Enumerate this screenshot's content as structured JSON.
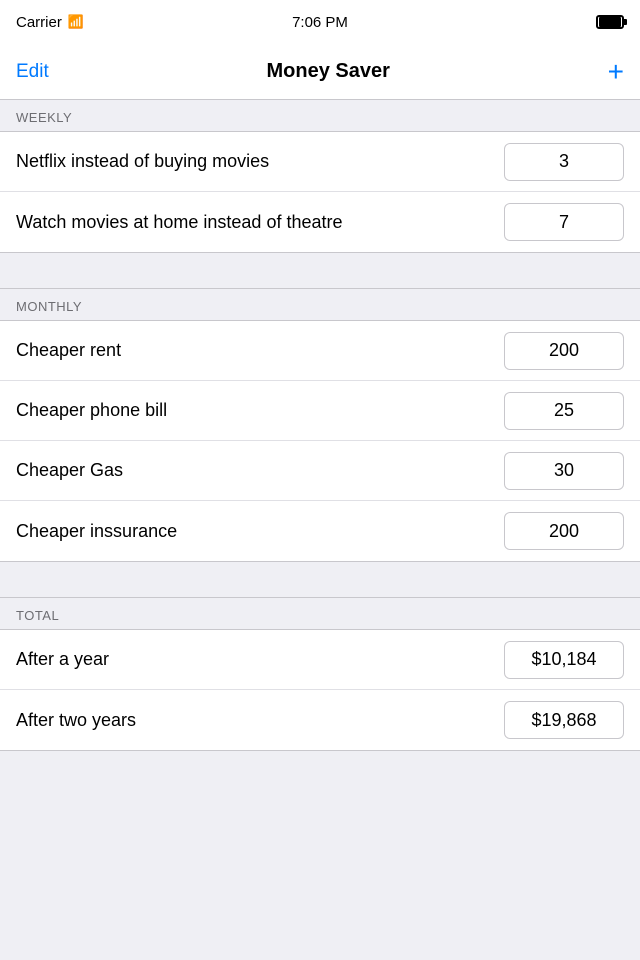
{
  "status_bar": {
    "carrier": "Carrier",
    "wifi": "WiFi",
    "time": "7:06 PM"
  },
  "nav": {
    "edit_label": "Edit",
    "title": "Money Saver",
    "add_label": "+"
  },
  "sections": [
    {
      "id": "weekly",
      "header": "WEEKLY",
      "rows": [
        {
          "label": "Netflix instead of buying movies",
          "value": "3"
        },
        {
          "label": "Watch movies at home instead of theatre",
          "value": "7"
        }
      ]
    },
    {
      "id": "monthly",
      "header": "MONTHLY",
      "rows": [
        {
          "label": "Cheaper rent",
          "value": "200"
        },
        {
          "label": "Cheaper phone bill",
          "value": "25"
        },
        {
          "label": "Cheaper Gas",
          "value": "30"
        },
        {
          "label": "Cheaper inssurance",
          "value": "200"
        }
      ]
    },
    {
      "id": "total",
      "header": "TOTAL",
      "rows": [
        {
          "label": "After a year",
          "value": "$10,184"
        },
        {
          "label": "After two years",
          "value": "$19,868"
        }
      ]
    }
  ]
}
